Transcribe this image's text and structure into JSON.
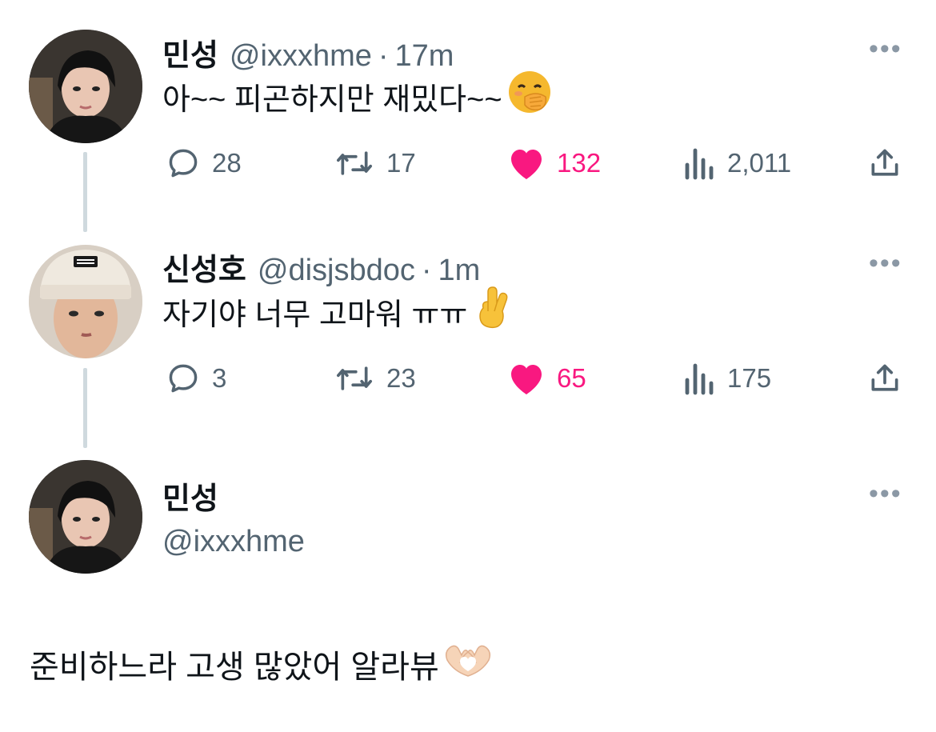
{
  "tweets": [
    {
      "name": "민성",
      "handle": "@ixxxhme",
      "sep": "·",
      "time": "17m",
      "text": "아~~ 피곤하지만 재밌다~~",
      "emoji": "hand-over-mouth",
      "replies": "28",
      "retweets": "17",
      "likes": "132",
      "views": "2,011",
      "liked": true
    },
    {
      "name": "신성호",
      "handle": "@disjsbdoc",
      "sep": "·",
      "time": "1m",
      "text": "자기야 너무 고마워 ㅠㅠ",
      "emoji": "crossed-fingers",
      "replies": "3",
      "retweets": "23",
      "likes": "65",
      "views": "175",
      "liked": true
    }
  ],
  "main_tweet": {
    "name": "민성",
    "handle": "@ixxxhme",
    "text": "준비하느라 고생 많았어 알라뷰",
    "emoji": "heart-hands"
  },
  "icons": {
    "more": "more-horizontal-icon",
    "reply": "reply-icon",
    "retweet": "retweet-icon",
    "like": "heart-icon",
    "views": "views-icon",
    "share": "share-icon"
  },
  "colors": {
    "like": "#f91880",
    "secondary_text": "#536471",
    "thread_line": "#cfd9de"
  }
}
